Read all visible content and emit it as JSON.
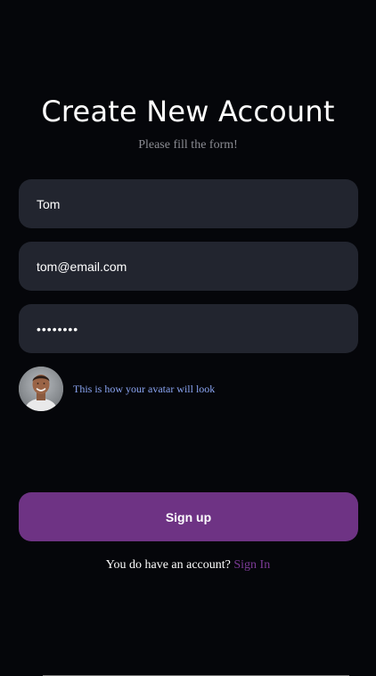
{
  "header": {
    "title": "Create New Account",
    "subtitle": "Please fill the form!"
  },
  "form": {
    "name_value": "Tom",
    "email_value": "tom@email.com",
    "password_value": "secret12"
  },
  "avatar": {
    "caption": "This is how your avatar will look"
  },
  "actions": {
    "signup_label": "Sign up",
    "signin_prompt": "You do have an account?",
    "signin_link": "Sign In"
  },
  "colors": {
    "background": "#05060a",
    "field_background": "#22252f",
    "accent": "#6e3384",
    "link": "#7b3a96",
    "caption": "#8aa4f2"
  }
}
